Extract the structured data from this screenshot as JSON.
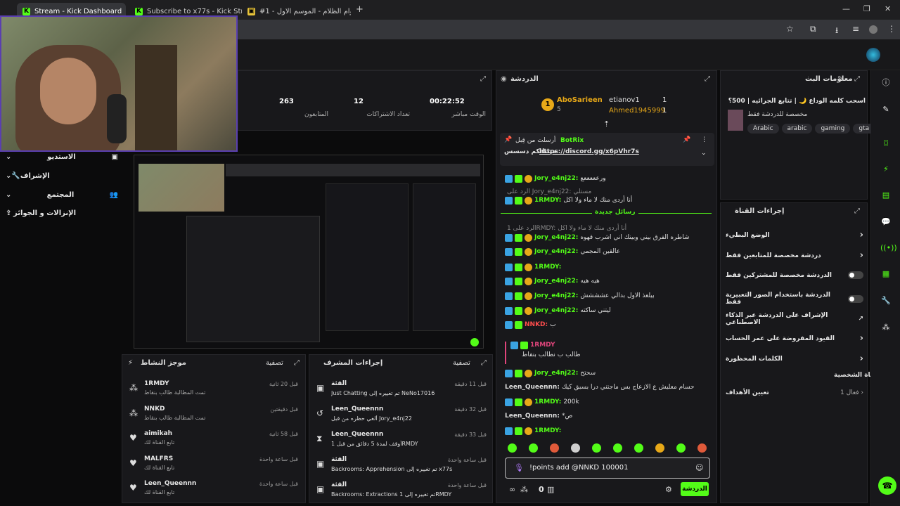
{
  "browser": {
    "tabs": [
      {
        "label": "Stream - Kick Dashboard",
        "favicon": "kick-icon"
      },
      {
        "label": "Subscribe to x77s - Kick Stream",
        "favicon": "kick-icon"
      },
      {
        "label": "#1 - أعوام الظلام - الموسم الاول",
        "favicon": "folder-icon"
      }
    ],
    "new_tab": "+"
  },
  "stats": [
    {
      "value": "263",
      "label": "المتابعون"
    },
    {
      "value": "12",
      "label": "تعداد الاشتراكات"
    },
    {
      "value": "00:22:52",
      "label": "الوقت مباشر"
    }
  ],
  "sidenav": [
    {
      "label": "الاستديو",
      "icon": "studio-icon"
    },
    {
      "label": "الإشراف",
      "icon": "wrench-icon"
    },
    {
      "label": "المجتمع",
      "icon": "community-icon"
    },
    {
      "label": "الإنزالات و الجوائز",
      "icon": "drops-icon"
    }
  ],
  "chat": {
    "title": "الدردشة",
    "leaders": [
      {
        "rank": "1",
        "name": "AboSarieen",
        "sub": "5"
      },
      {
        "name": "etianov1",
        "count": "1"
      },
      {
        "name": "Ahmed1945999",
        "count": "1"
      }
    ],
    "pinned": {
      "by": "BotRix",
      "label": "أرسلت من قِبل",
      "text": "حبيباتكم دسسس",
      "link": "https://discord.gg/x6pVhr7s"
    },
    "new_messages": "رسائل جديدة",
    "messages": [
      {
        "user": "Jory_e4nj22:",
        "text": "ورعععععع"
      },
      {
        "user": "",
        "text": "الرد على Jory_e4nj22: مستلي"
      },
      {
        "user": "1RMDY:",
        "text": "أنا أردى منك لا ماء ولا اكل"
      },
      {
        "user": "",
        "text": "الرد على 1RMDY: أنا أردى منك لا ماء ولا اكل"
      },
      {
        "user": "Jory_e4nj22:",
        "text": "شاطره الفرق بيني وبينك اني اشرب قهوه"
      },
      {
        "user": "Jory_e4nj22:",
        "text": "عالقين المجمي"
      },
      {
        "user": "1RMDY:",
        "text": ""
      },
      {
        "user": "Jory_e4nj22:",
        "text": "هيه هيه"
      },
      {
        "user": "Jory_e4nj22:",
        "text": "بيلغذ الاول بدالي عشششش"
      },
      {
        "user": "Jory_e4nj22:",
        "text": "ليتني ساكته"
      },
      {
        "user": "NNKD:",
        "text": "ب"
      },
      {
        "user": "1RMDY",
        "text": "طالب ب نطالب بنقاط"
      },
      {
        "user": "Jory_e4nj22:",
        "text": "سحتح"
      },
      {
        "user": "Leen_Queennn:",
        "text": "حسام معليش ع الازعاج بس ماجتني درا بسبق كيك"
      },
      {
        "user": "1RMDY:",
        "text": "200k"
      },
      {
        "user": "Leen_Queennn:",
        "text": "*ص"
      },
      {
        "user": "1RMDY:",
        "text": ""
      }
    ],
    "input_value": "!points add @NNKD 100001",
    "send_label": "الدردشة",
    "points": "0"
  },
  "stream_info": {
    "title": "معلومات البث",
    "stream_title": "اسحب كلمه الوداع 🌙 | تتابع الجرائيه | 500؟",
    "category": "مخصصة للدردشة فقط",
    "tags": [
      "Arabic",
      "arabic",
      "gaming",
      "gta"
    ]
  },
  "channel_actions": {
    "title": "إجراءات القناة",
    "items": [
      {
        "label": "الوضع البطيء",
        "control": "chevron"
      },
      {
        "label": "دردشة مخصصة للمتابعين فقط",
        "control": "chevron"
      },
      {
        "label": "الدردشة مخصصة للمشتركين فقط",
        "control": "toggle"
      },
      {
        "label": "الدردشة باستخدام الصور التعبيرية فقط",
        "control": "toggle"
      },
      {
        "label": "الإشراف على الدردشة عبر الذكاء الاصطناعي",
        "control": "external"
      },
      {
        "label": "القيود المفروضة على عمر الحساب",
        "control": "chevron"
      },
      {
        "label": "الكلمات المحظورة",
        "control": "chevron"
      }
    ],
    "section": "القناة الشخصية",
    "goal": {
      "label": "تعيين الأهداف",
      "status": "1 فعال"
    }
  },
  "activity": {
    "title": "موجز النشاط",
    "filter": "تصفية",
    "items": [
      {
        "user": "1RMDY",
        "desc": "تمت المطالبة طالب بنقاط",
        "time": "قبل 20 ثانية"
      },
      {
        "user": "NNKD",
        "desc": "تمت المطالبة طالب بنقاط",
        "time": "قبل دقيقتين"
      },
      {
        "user": "aimikah",
        "desc": "تابع القناة لك",
        "time": "قبل 58 ثانية"
      },
      {
        "user": "MALFRS",
        "desc": "تابع القناة لك",
        "time": "قبل ساعة واحدة"
      },
      {
        "user": "Leen_Queennn",
        "desc": "تابع القناة لك",
        "time": "قبل ساعة واحدة"
      }
    ]
  },
  "mod_actions": {
    "title": "إجراءات المشرف",
    "filter": "تصفية",
    "items": [
      {
        "user": "القئة",
        "desc": "Just Chatting تم تغييره إلى NeNo17016",
        "time": "قبل 11 دقيقة"
      },
      {
        "user": "Leen_Queennn",
        "desc": "ألغي حظره من قبل Jory_e4nj22",
        "time": "قبل 32 دقيقة"
      },
      {
        "user": "Leen_Queennn",
        "desc": "أوقف لمدة 5 دقائق من قبل 1RMDY",
        "time": "قبل 33 دقيقة"
      },
      {
        "user": "القئة",
        "desc": "Backrooms: Apprehension تم تغييره إلى x77s",
        "time": "قبل ساعة واحدة"
      },
      {
        "user": "القئة",
        "desc": "Backrooms: Extractions تم تغييره إلى 1RMDY",
        "time": "قبل ساعة واحدة"
      }
    ]
  }
}
